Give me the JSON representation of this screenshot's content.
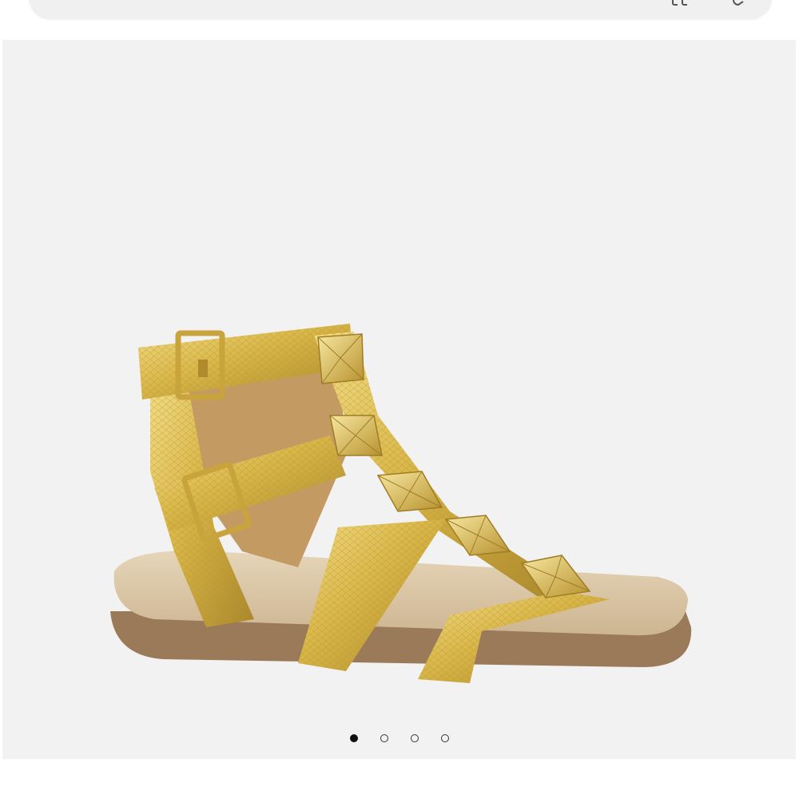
{
  "search": {
    "camera_icon": "camera-icon",
    "search_icon": "search-icon"
  },
  "gallery": {
    "image_subject": "sandal-image",
    "pagination": {
      "total": 4,
      "active_index": 0
    }
  },
  "colors": {
    "gallery_bg": "#f2f2f2",
    "gold": "#d9b648",
    "gold_dark": "#a9862a",
    "footbed": "#d8c3a3",
    "sole": "#9b7a5a",
    "dot_active": "#111111"
  }
}
